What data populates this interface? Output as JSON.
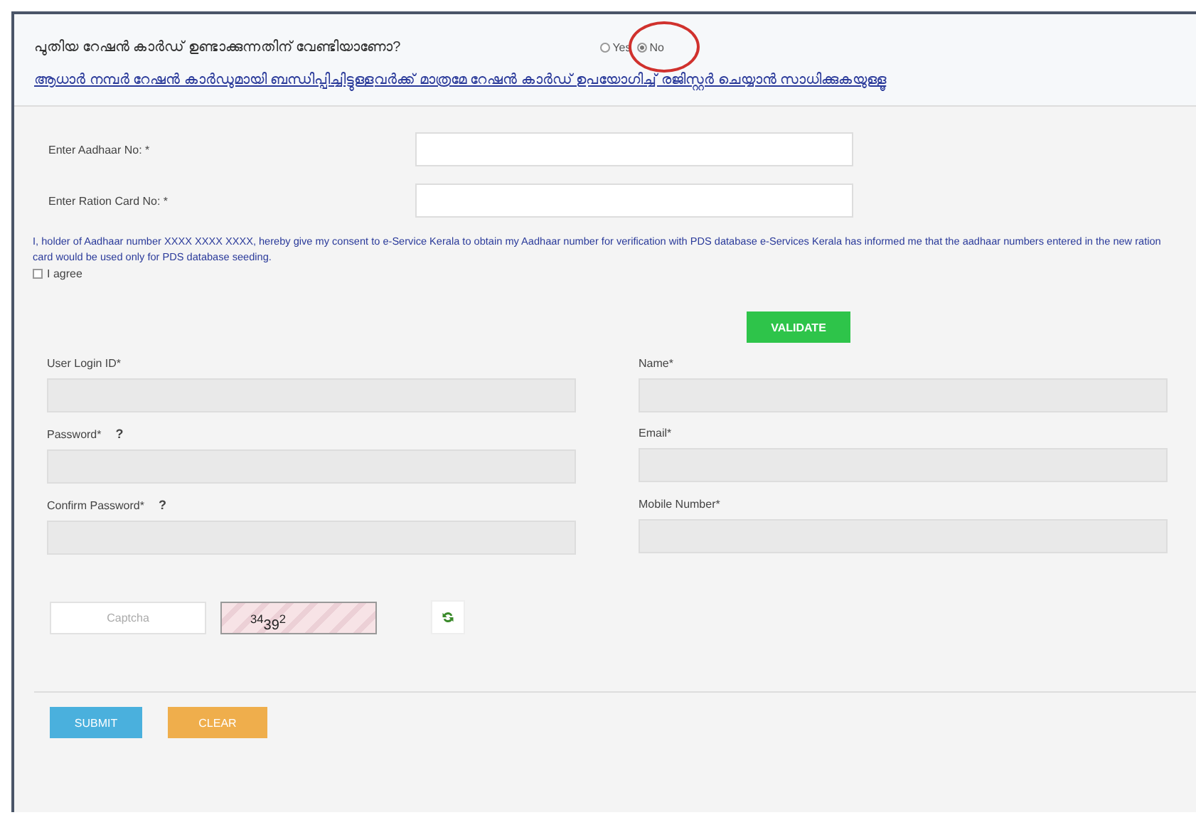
{
  "question": {
    "text": "പുതിയ റേഷൻ കാർഡ് ഉണ്ടാക്കുന്നതിന് വേണ്ടിയാണോ?",
    "options": [
      {
        "label": "Yes",
        "selected": false
      },
      {
        "label": "No",
        "selected": true,
        "circled": true
      }
    ]
  },
  "notice": "ആധാർ നമ്പർ റേഷൻ കാർഡുമായി ബന്ധിപ്പിച്ചിട്ടുള്ളവർക്ക് മാത്രമേ റേഷൻ കാർഡ് ഉപയോഗിച്ച് രജിസ്റ്റർ ചെയ്യാൻ സാധിക്കുകയുള്ളൂ",
  "lookup_fields": [
    {
      "label": "Enter Aadhaar No: *"
    },
    {
      "label": "Enter Ration Card No: *"
    }
  ],
  "consent": {
    "text": "I, holder of Aadhaar number XXXX XXXX XXXX, hereby give my consent to e-Service Kerala to obtain my Aadhaar number for verification with PDS database e-Services Kerala has informed me that the aadhaar numbers entered in the new ration card would be used only for PDS database seeding.",
    "checkbox_label": "I agree",
    "checked": false
  },
  "validate_button": "VALIDATE",
  "account_fields": [
    {
      "label": "User Login ID*",
      "help": false
    },
    {
      "label": "Name*",
      "help": false
    },
    {
      "label": "Password*",
      "help": true
    },
    {
      "label": "Email*",
      "help": false
    },
    {
      "label": "Confirm Password*",
      "help": true
    },
    {
      "label": "Mobile Number*",
      "help": false
    }
  ],
  "help_mark": "?",
  "captcha": {
    "placeholder": "Captcha",
    "image_text": "$^{34}$39$^{2}$"
  },
  "buttons": [
    {
      "label": "SUBMIT",
      "kind": "primary"
    },
    {
      "label": "CLEAR",
      "kind": "warning"
    }
  ]
}
